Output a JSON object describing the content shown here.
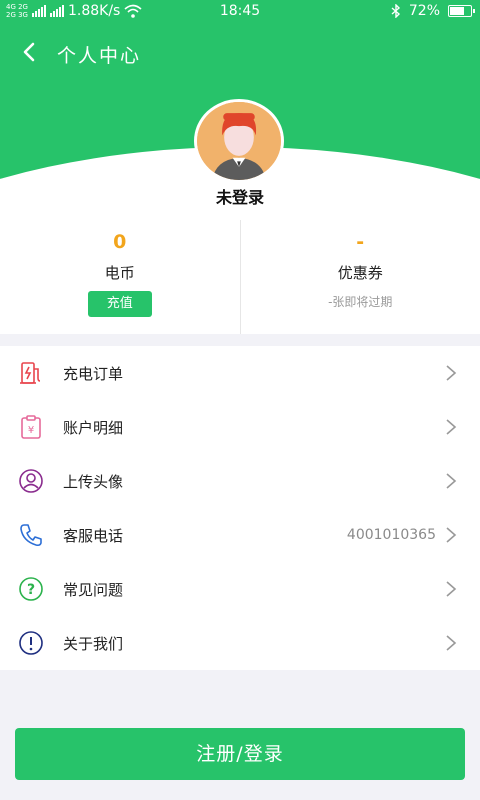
{
  "status_bar": {
    "network_top": "4G 2G",
    "network_bottom": "2G 3G",
    "speed": "1.88K/s",
    "time": "18:45",
    "battery": "72%",
    "battery_level": 0.72
  },
  "navbar": {
    "title": "个人中心"
  },
  "profile": {
    "username": "未登录"
  },
  "stats": {
    "coins": {
      "value": "0",
      "label": "电币",
      "button": "充值"
    },
    "coupons": {
      "value": "-",
      "label": "优惠券",
      "sub": "-张即将过期"
    }
  },
  "menu": {
    "items": [
      {
        "label": "充电订单",
        "icon": "charging-pile-icon"
      },
      {
        "label": "账户明细",
        "icon": "bill-icon"
      },
      {
        "label": "上传头像",
        "icon": "user-circle-icon"
      },
      {
        "label": "客服电话",
        "icon": "phone-icon",
        "value": "4001010365"
      },
      {
        "label": "常见问题",
        "icon": "question-circle-icon"
      },
      {
        "label": "关于我们",
        "icon": "info-circle-icon"
      }
    ]
  },
  "footer": {
    "button": "注册/登录"
  },
  "colors": {
    "brand": "#27c36a",
    "accent": "#f2a51c"
  }
}
